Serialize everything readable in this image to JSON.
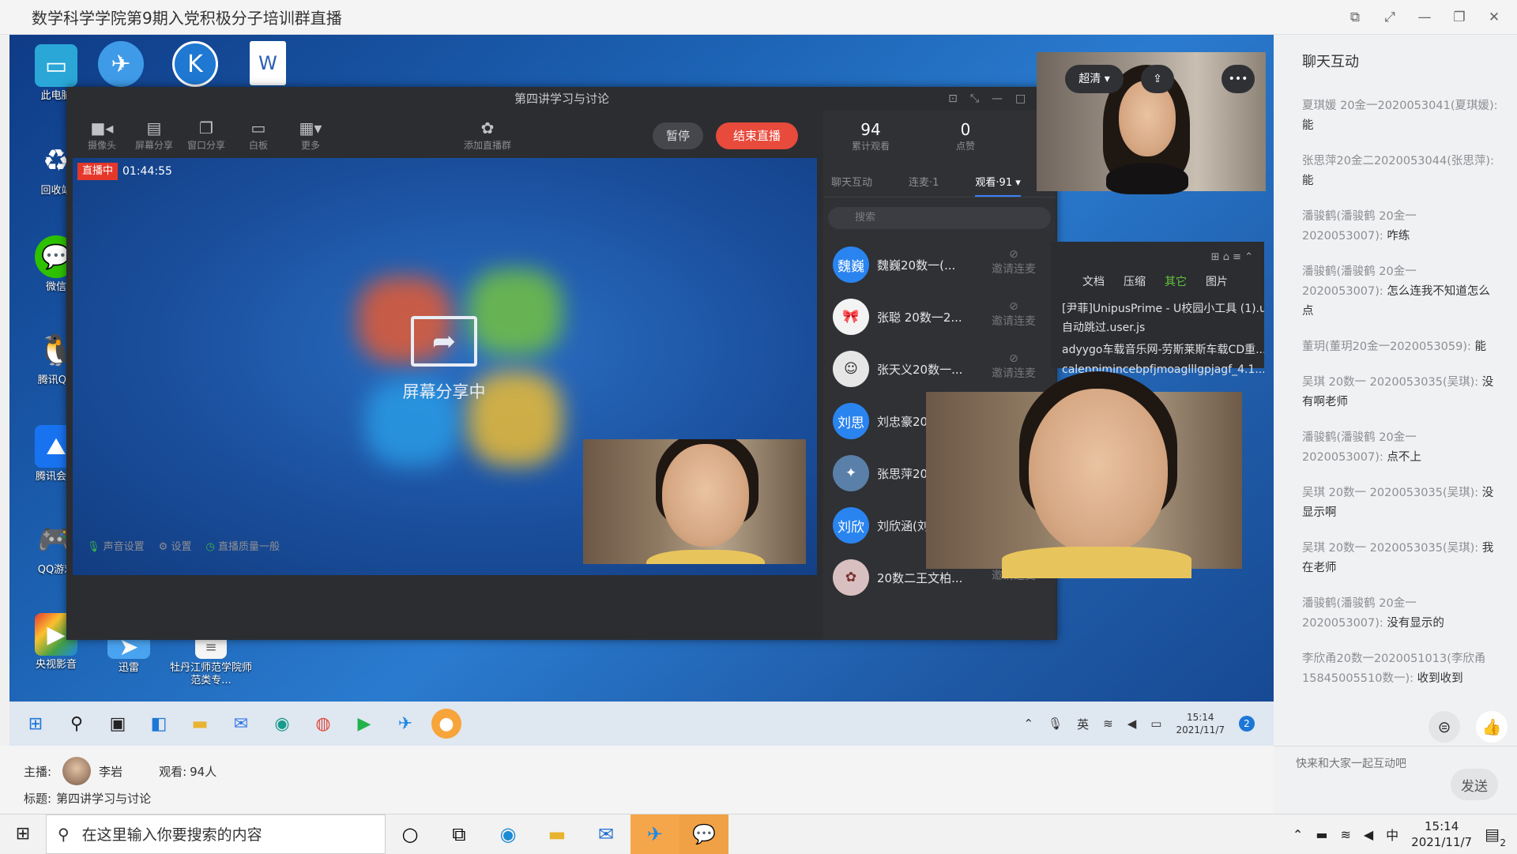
{
  "window": {
    "title": "数学科学学院第9期入党积极分子培训群直播"
  },
  "desktop": {
    "icons": [
      "此电脑",
      "回收站",
      "微信",
      "腾讯QQ",
      "腾讯会议",
      "QQ游戏",
      "央视影音",
      "迅雷",
      "牡丹江师范学院师范类专..."
    ]
  },
  "live_app": {
    "title": "第四讲学习与讨论",
    "toolbar": [
      "摄像头",
      "屏幕分享",
      "窗口分享",
      "白板",
      "更多"
    ],
    "add_speaker": "添加直播群",
    "pause": "暂停",
    "end": "结束直播",
    "live_tag": "直播中",
    "live_time": "01:44:55",
    "share_text": "屏幕分享中",
    "bottom": [
      "声音设置",
      "设置",
      "直播质量一般"
    ],
    "stats": [
      {
        "num": "94",
        "label": "累计观看"
      },
      {
        "num": "0",
        "label": "点赞"
      }
    ],
    "tabs": [
      "聊天互动",
      "连麦·1",
      "观看·91"
    ],
    "search_placeholder": "搜索",
    "viewers": [
      {
        "avatar": "魏巍",
        "name": "魏巍20数一(...",
        "color": "#2a84f0"
      },
      {
        "avatar": "",
        "name": "张聪 20数一2...",
        "color": "#f3f3f3"
      },
      {
        "avatar": "",
        "name": "张天义20数一...",
        "color": "#e6e6e6"
      },
      {
        "avatar": "刘思",
        "name": "刘忠豪20",
        "color": "#2a84f0"
      },
      {
        "avatar": "",
        "name": "张思萍20",
        "color": "#5a7fa8"
      },
      {
        "avatar": "刘欣",
        "name": "刘欣涵(刘",
        "color": "#2a84f0"
      },
      {
        "avatar": "",
        "name": "20数二王文柏...",
        "color": "#d9c0c0"
      }
    ],
    "invite": "邀请连麦"
  },
  "file_panel": {
    "tabs": [
      "文档",
      "压缩",
      "其它",
      "图片"
    ],
    "lines": [
      "[尹菲]UnipusPrime - U校园小工具 (1).u...",
      "自动跳过.user.js",
      "adyygo车载音乐网-劳斯莱斯车载CD重...",
      "calenpjmjncebpfjmoaglllgpjagf_4.1..."
    ]
  },
  "top_video": {
    "quality": "超清"
  },
  "inner_taskbar": {
    "lang": "英",
    "time": "15:14",
    "date": "2021/11/7",
    "badge": "2"
  },
  "chat": {
    "title": "聊天互动",
    "messages": [
      {
        "from": "夏琪媛 20金一2020053041(夏琪媛):",
        "text": "能"
      },
      {
        "from": "张思萍20金二2020053044(张思萍):",
        "text": "能"
      },
      {
        "from": "潘骏鹤(潘骏鹤 20金一 2020053007):",
        "text": "咋练"
      },
      {
        "from": "潘骏鹤(潘骏鹤 20金一 2020053007):",
        "text": "怎么连我不知道怎么点"
      },
      {
        "from": "董玥(董玥20金一2020053059):",
        "text": "能"
      },
      {
        "from": "吴琪 20数一 2020053035(吴琪):",
        "text": "没有啊老师"
      },
      {
        "from": "潘骏鹤(潘骏鹤 20金一 2020053007):",
        "text": "点不上"
      },
      {
        "from": "吴琪 20数一 2020053035(吴琪):",
        "text": "没显示啊"
      },
      {
        "from": "吴琪 20数一 2020053035(吴琪):",
        "text": "我在老师"
      },
      {
        "from": "潘骏鹤(潘骏鹤 20金一 2020053007):",
        "text": "没有显示的"
      },
      {
        "from": "李欣甬20数一2020051013(李欣甬15845005510数一):",
        "text": "收到收到"
      }
    ],
    "input_placeholder": "快来和大家一起互动吧",
    "send": "发送"
  },
  "info": {
    "host_label": "主播:",
    "host_name": "李岩",
    "viewers_label": "观看:",
    "viewers_value": "94人",
    "topic_label": "标题:",
    "topic_value": "第四讲学习与讨论"
  },
  "os_taskbar": {
    "search_placeholder": "在这里输入你要搜索的内容",
    "ime": "中",
    "time": "15:14",
    "date": "2021/11/7",
    "notif_badge": "2"
  }
}
